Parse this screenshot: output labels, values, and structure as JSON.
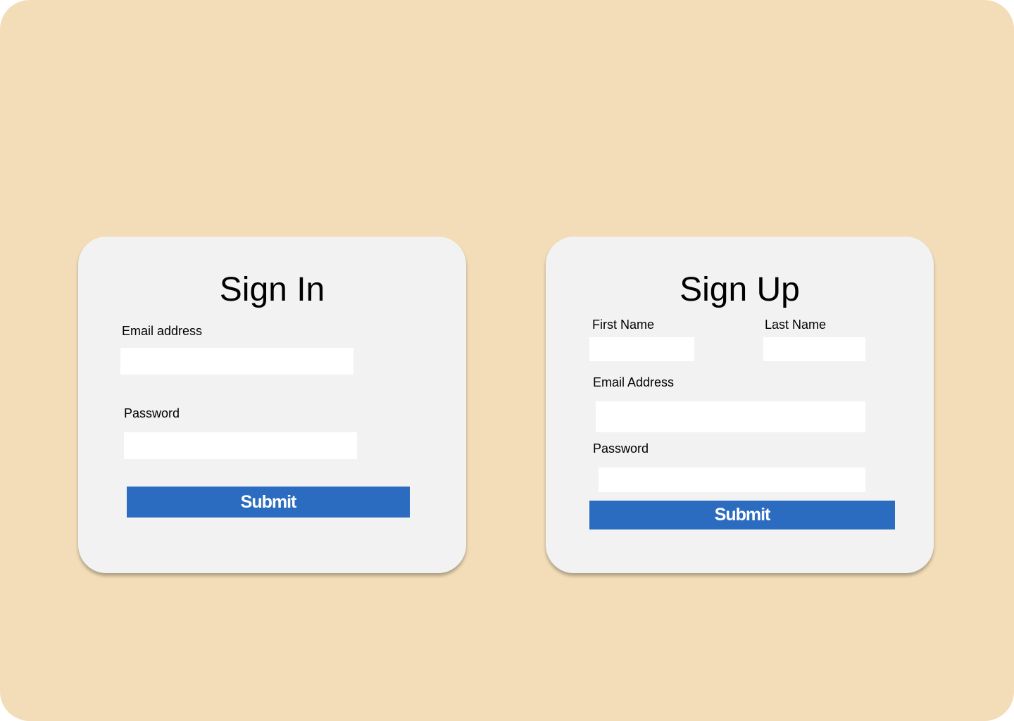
{
  "colors": {
    "background": "#f2ddb8",
    "card": "#f2f2f2",
    "input": "#ffffff",
    "button": "#2b6cc0",
    "button_text": "#ffffff"
  },
  "sign_in": {
    "title": "Sign In",
    "email_label": "Email address",
    "email_value": "",
    "password_label": "Password",
    "password_value": "",
    "submit_label": "Submit"
  },
  "sign_up": {
    "title": "Sign Up",
    "first_name_label": "First Name",
    "first_name_value": "",
    "last_name_label": "Last Name",
    "last_name_value": "",
    "email_label": "Email Address",
    "email_value": "",
    "password_label": "Password",
    "password_value": "",
    "submit_label": "Submit"
  }
}
